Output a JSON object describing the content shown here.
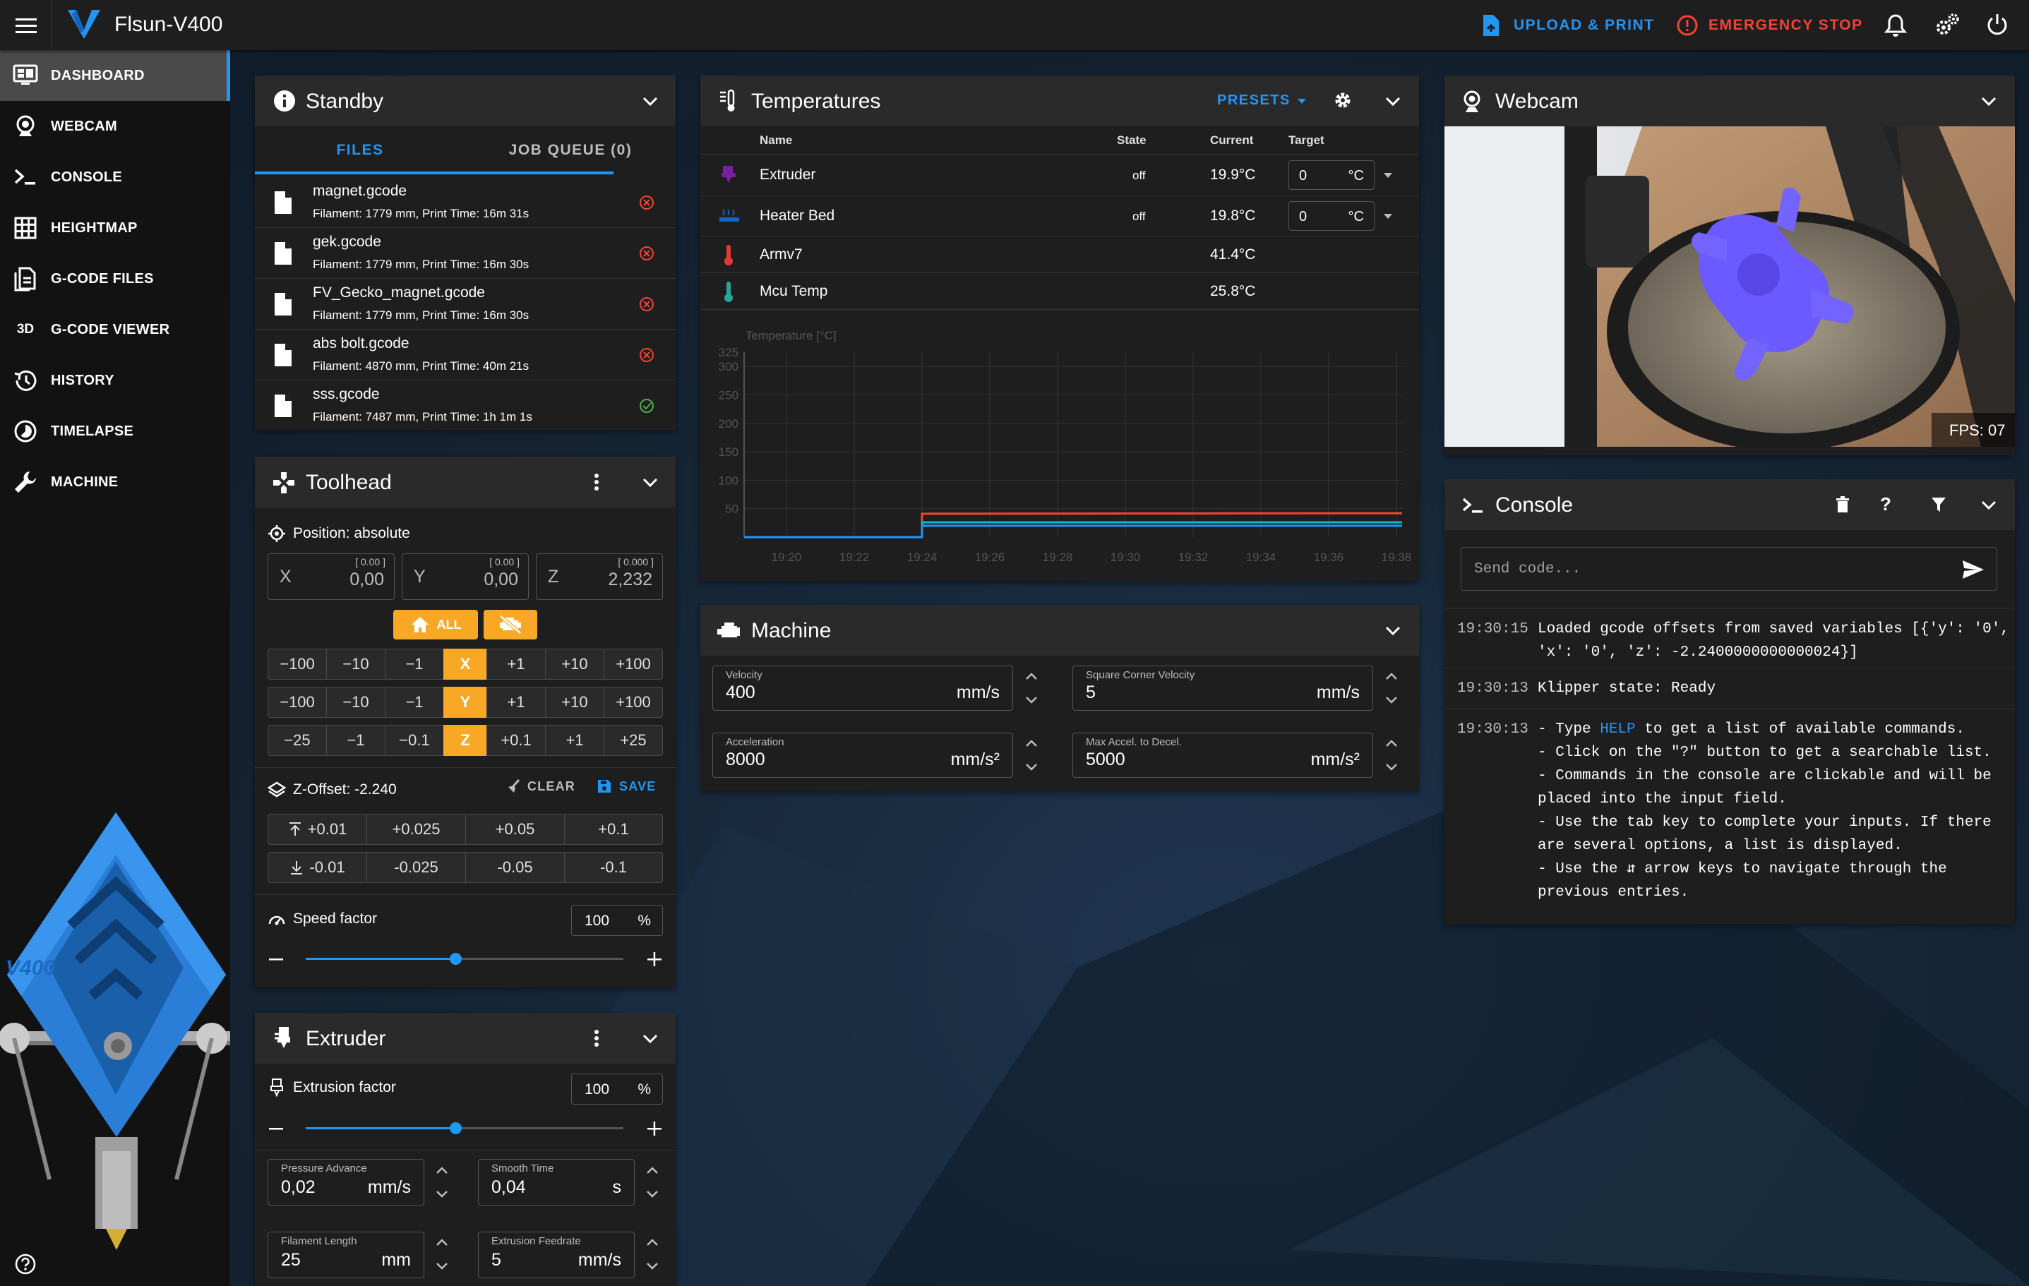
{
  "app": {
    "title": "Flsun-V400"
  },
  "topbar": {
    "upload_label": "UPLOAD & PRINT",
    "emergency_label": "EMERGENCY STOP"
  },
  "colors": {
    "accent": "#2196f3",
    "danger": "#f44336",
    "success": "#4caf50",
    "warning": "#f9a825",
    "background": "#1e1e1e",
    "chart_red": "#f44336",
    "chart_cyan": "#00bcd4",
    "chart_blue": "#2196f3"
  },
  "sidebar": {
    "items": [
      {
        "label": "DASHBOARD",
        "icon": "monitor-dashboard-icon"
      },
      {
        "label": "WEBCAM",
        "icon": "webcam-icon"
      },
      {
        "label": "CONSOLE",
        "icon": "console-icon"
      },
      {
        "label": "HEIGHTMAP",
        "icon": "grid-icon"
      },
      {
        "label": "G-CODE FILES",
        "icon": "file-document-icon"
      },
      {
        "label": "G-CODE VIEWER",
        "icon": "3d-icon",
        "icon_text": "3D"
      },
      {
        "label": "HISTORY",
        "icon": "history-icon"
      },
      {
        "label": "TIMELAPSE",
        "icon": "timelapse-icon"
      },
      {
        "label": "MACHINE",
        "icon": "wrench-icon"
      }
    ],
    "printer_logo_text": "V400"
  },
  "standby": {
    "title": "Standby",
    "tabs": [
      "FILES",
      "JOB QUEUE (0)"
    ],
    "files": [
      {
        "name": "magnet.gcode",
        "meta": "Filament: 1779 mm, Print Time: 16m 31s",
        "status": "error"
      },
      {
        "name": "gek.gcode",
        "meta": "Filament: 1779 mm, Print Time: 16m 30s",
        "status": "error"
      },
      {
        "name": "FV_Gecko_magnet.gcode",
        "meta": "Filament: 1779 mm, Print Time: 16m 30s",
        "status": "error"
      },
      {
        "name": "abs bolt.gcode",
        "meta": "Filament: 4870 mm, Print Time: 40m 21s",
        "status": "error"
      },
      {
        "name": "sss.gcode",
        "meta": "Filament: 7487 mm, Print Time: 1h 1m 1s",
        "status": "success"
      }
    ]
  },
  "toolhead": {
    "title": "Toolhead",
    "position_label": "Position: absolute",
    "axes": [
      {
        "name": "X",
        "value": "0,00",
        "target": "[ 0.00 ]"
      },
      {
        "name": "Y",
        "value": "0,00",
        "target": "[ 0.00 ]"
      },
      {
        "name": "Z",
        "value": "2,232",
        "target": "[ 0.000 ]"
      }
    ],
    "home_all_label": "ALL",
    "jog_rows": [
      {
        "axis": "X",
        "minus": [
          "−100",
          "−10",
          "−1"
        ],
        "plus": [
          "+1",
          "+10",
          "+100"
        ]
      },
      {
        "axis": "Y",
        "minus": [
          "−100",
          "−10",
          "−1"
        ],
        "plus": [
          "+1",
          "+10",
          "+100"
        ]
      },
      {
        "axis": "Z",
        "minus": [
          "−25",
          "−1",
          "−0.1"
        ],
        "plus": [
          "+0.1",
          "+1",
          "+25"
        ]
      }
    ],
    "zoffset_label": "Z-Offset: -2.240",
    "clear_label": "CLEAR",
    "save_label": "SAVE",
    "zoffset_up": [
      "+0.01",
      "+0.025",
      "+0.05",
      "+0.1"
    ],
    "zoffset_down": [
      "-0.01",
      "-0.025",
      "-0.05",
      "-0.1"
    ],
    "speed_label": "Speed factor",
    "speed_value": "100",
    "speed_unit": "%",
    "speed_fraction": 0.47
  },
  "extruder": {
    "title": "Extruder",
    "factor_label": "Extrusion factor",
    "factor_value": "100",
    "factor_unit": "%",
    "factor_fraction": 0.47,
    "fields": [
      {
        "label": "Pressure Advance",
        "value": "0,02",
        "unit": "mm/s"
      },
      {
        "label": "Smooth Time",
        "value": "0,04",
        "unit": "s"
      },
      {
        "label": "Filament Length",
        "value": "25",
        "unit": "mm"
      },
      {
        "label": "Extrusion Feedrate",
        "value": "5",
        "unit": "mm/s"
      }
    ]
  },
  "temperatures": {
    "title": "Temperatures",
    "presets_label": "PRESETS",
    "columns": [
      "Name",
      "State",
      "Current",
      "Target"
    ],
    "rows": [
      {
        "name": "Extruder",
        "state": "off",
        "current": "19.9°C",
        "target": "0",
        "unit": "°C",
        "icon": "extruder-icon",
        "color": "#7b1fa2"
      },
      {
        "name": "Heater Bed",
        "state": "off",
        "current": "19.8°C",
        "target": "0",
        "unit": "°C",
        "icon": "heater-bed-icon",
        "color": "#1565c0"
      },
      {
        "name": "Armv7",
        "state": "",
        "current": "41.4°C",
        "target": "",
        "unit": "",
        "icon": "thermometer-icon",
        "color": "#e53935"
      },
      {
        "name": "Mcu Temp",
        "state": "",
        "current": "25.8°C",
        "target": "",
        "unit": "",
        "icon": "thermometer-icon",
        "color": "#26a69a"
      }
    ]
  },
  "chart_data": {
    "type": "line",
    "title": "",
    "ylabel": "Temperature [°C]",
    "ylim": [
      0,
      325
    ],
    "yticks": [
      50,
      100,
      150,
      200,
      250,
      300,
      325
    ],
    "xticks": [
      "19:20",
      "19:22",
      "19:24",
      "19:26",
      "19:28",
      "19:30",
      "19:32",
      "19:34",
      "19:36",
      "19:38"
    ],
    "x": [
      "19:20",
      "19:24",
      "19:24",
      "19:30",
      "19:38"
    ],
    "series": [
      {
        "name": "",
        "color": "#f44336",
        "values": [
          0,
          0,
          41,
          41.5,
          42
        ]
      },
      {
        "name": "",
        "color": "#00bcd4",
        "values": [
          0,
          0,
          26,
          26,
          26
        ]
      },
      {
        "name": "",
        "color": "#2196f3",
        "values": [
          0,
          0,
          20,
          20,
          20
        ]
      }
    ],
    "grid": true
  },
  "machine": {
    "title": "Machine",
    "fields": [
      {
        "label": "Velocity",
        "value": "400",
        "unit": "mm/s"
      },
      {
        "label": "Square Corner Velocity",
        "value": "5",
        "unit": "mm/s"
      },
      {
        "label": "Acceleration",
        "value": "8000",
        "unit": "mm/s²"
      },
      {
        "label": "Max Accel. to Decel.",
        "value": "5000",
        "unit": "mm/s²"
      }
    ]
  },
  "webcam": {
    "title": "Webcam",
    "fps": "FPS: 07"
  },
  "console": {
    "title": "Console",
    "placeholder": "Send code...",
    "entries": [
      {
        "time": "19:30:15",
        "lines": [
          "Loaded gcode offsets from saved variables [{'y': '0',",
          "'x': '0', 'z': -2.2400000000000024}]"
        ]
      },
      {
        "time": "19:30:13",
        "lines": [
          "Klipper state: Ready"
        ]
      }
    ],
    "help_entry": {
      "time": "19:30:13",
      "line1_pre": "- Type ",
      "line1_link": "HELP",
      "line1_post": " to get a list of available commands.",
      "lines": [
        "- Click on the \"?\" button to get a searchable list.",
        "- Commands in the console are clickable and will be",
        "placed into the input field.",
        "- Use the tab key to complete your inputs. If there",
        "are several options, a list is displayed.",
        "- Use the ⇵ arrow keys to navigate through the",
        "previous entries."
      ]
    }
  }
}
